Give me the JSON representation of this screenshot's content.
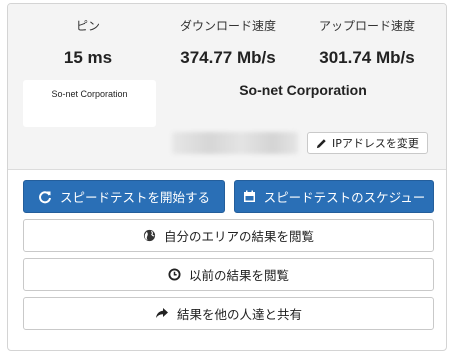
{
  "metrics": {
    "ping_label": "ピン",
    "ping_value": "15 ms",
    "download_label": "ダウンロード速度",
    "download_value": "374.77 Mb/s",
    "upload_label": "アップロード速度",
    "upload_value": "301.74 Mb/s"
  },
  "isp": {
    "logo_text": "So-net Corporation",
    "name": "So-net Corporation"
  },
  "ip": {
    "change_label": "IPアドレスを変更"
  },
  "actions": {
    "start_test": "スピードテストを開始する",
    "schedule_test": "スピードテストのスケジュー",
    "view_area_results": "自分のエリアの結果を閲覧",
    "view_past_results": "以前の結果を閲覧",
    "share_results": "結果を他の人達と共有"
  },
  "icons": {
    "refresh": "refresh-icon",
    "calendar": "calendar-icon",
    "globe": "globe-icon",
    "clock": "clock-icon",
    "share": "share-icon",
    "pencil": "pencil-icon"
  },
  "colors": {
    "primary": "#2a6fb6",
    "top_bg": "#f4f4f4"
  }
}
